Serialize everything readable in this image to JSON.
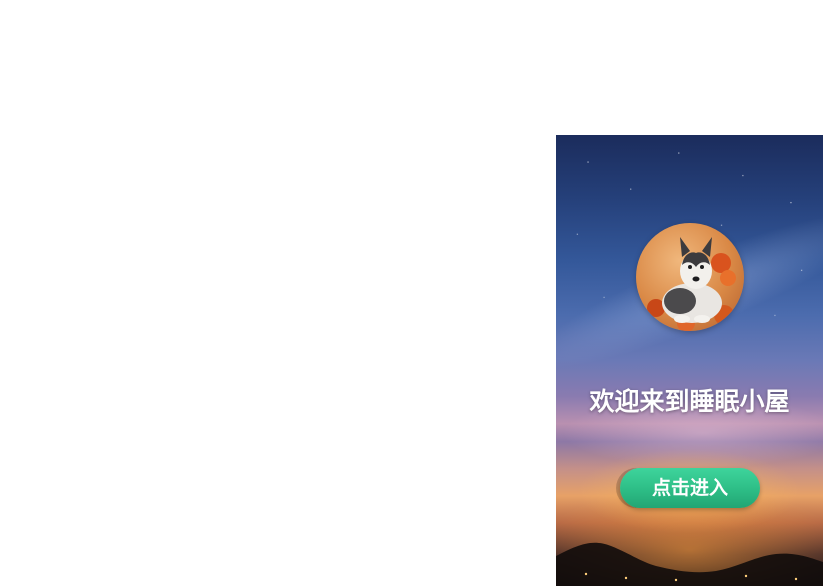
{
  "welcome": {
    "title": "欢迎来到睡眠小屋",
    "enter_label": "点击进入"
  },
  "avatar": {
    "icon": "husky-dog-avatar"
  },
  "colors": {
    "button": "#2dbd86",
    "text": "#ffffff",
    "sky_top": "#1b2c5c"
  }
}
